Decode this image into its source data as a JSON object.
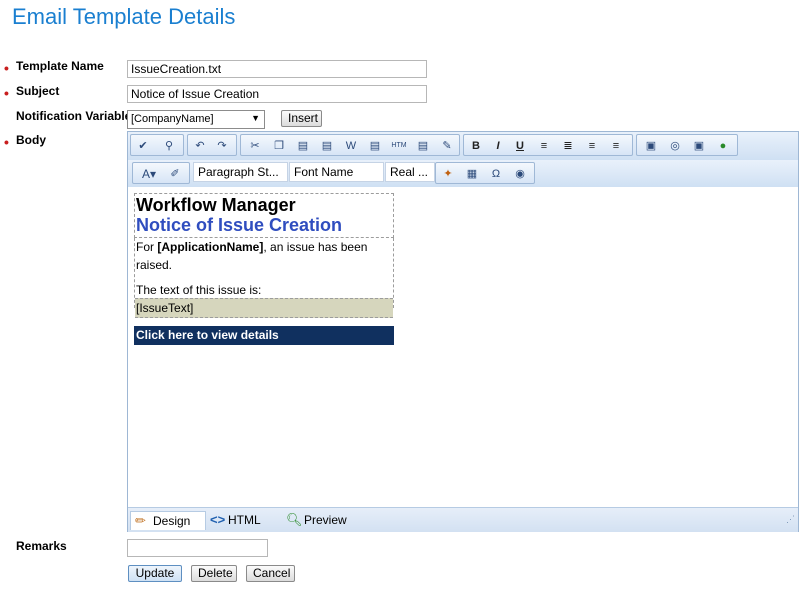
{
  "page": {
    "title": "Email Template Details"
  },
  "form": {
    "template_name": {
      "label": "Template Name",
      "value": "IssueCreation.txt"
    },
    "subject": {
      "label": "Subject",
      "value": "Notice of Issue Creation"
    },
    "notification_variable": {
      "label": "Notification Variable",
      "selected": "[CompanyName]",
      "insert_label": "Insert"
    },
    "body": {
      "label": "Body"
    },
    "remarks": {
      "label": "Remarks",
      "value": ""
    }
  },
  "toolbar": {
    "paragraph_style": "Paragraph St...",
    "font_name": "Font Name",
    "font_size": "Real ...",
    "icons_row1": [
      "spellcheck-icon",
      "find-replace-icon",
      "undo-icon",
      "redo-icon",
      "cut-icon",
      "copy-icon",
      "paste-icon",
      "paste-text-icon",
      "paste-word-icon",
      "paste-plain-icon",
      "paste-html-icon",
      "paste-special-icon",
      "format-stripper-icon",
      "bold-icon",
      "italic-icon",
      "underline-icon",
      "align-center-icon",
      "justify-icon",
      "align-left-icon",
      "align-right-icon",
      "image-manager-icon",
      "flash-manager-icon",
      "media-manager-icon",
      "hyperlink-manager-icon"
    ],
    "icons_row2": [
      "font-color-icon",
      "background-color-icon",
      "insert-custom-icon",
      "insert-table-icon",
      "insert-symbol-icon",
      "form-element-icon"
    ]
  },
  "content": {
    "heading1": "Workflow Manager",
    "heading2": "Notice of Issue Creation",
    "line1_prefix": "For ",
    "line1_bold": "[ApplicationName]",
    "line1_suffix": ", an issue has been raised.",
    "line2": "The text of this issue is:",
    "issue_text": "[IssueText]",
    "link_text": "Click here to view details"
  },
  "editor_tabs": [
    {
      "label": "Design",
      "icon": "pencil-icon"
    },
    {
      "label": "HTML",
      "icon": "code-icon"
    },
    {
      "label": "Preview",
      "icon": "magnifier-icon"
    }
  ],
  "actions": {
    "update": "Update",
    "delete": "Delete",
    "cancel": "Cancel"
  },
  "colors": {
    "title": "#1a7fd0",
    "bullet": "#c81e1e",
    "heading2": "#2f4dbf",
    "issue_bg": "#d6d6bd",
    "link_bg": "#10305f"
  }
}
